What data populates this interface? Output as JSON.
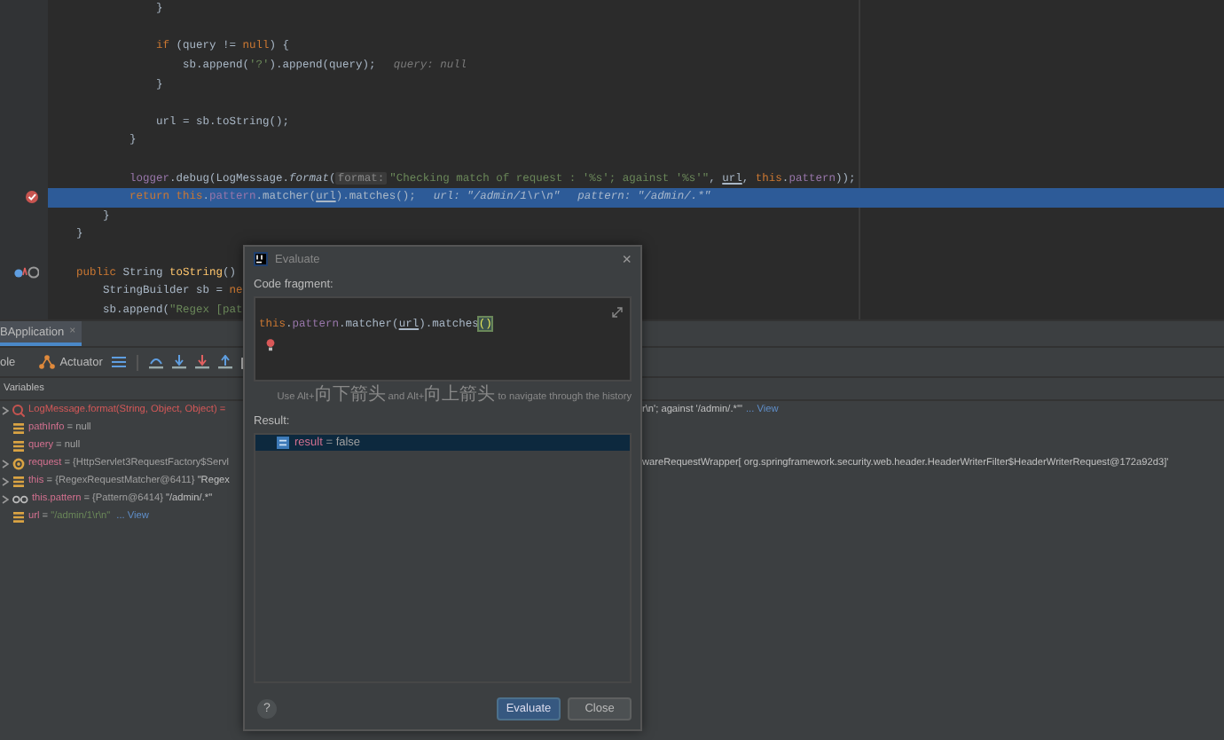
{
  "editor": {
    "lines": [
      {
        "kind": "code",
        "segments": [
          {
            "t": "                }",
            "kind": "plain"
          }
        ]
      },
      {
        "kind": "blank"
      },
      {
        "kind": "code",
        "segments": [
          {
            "t": "                if",
            "kind": "kw"
          },
          {
            "t": " (query != ",
            "kind": "plain"
          },
          {
            "t": "null",
            "kind": "kw"
          },
          {
            "t": ") {",
            "kind": "plain"
          }
        ]
      },
      {
        "kind": "code",
        "segments": [
          {
            "t": "                    sb.append(",
            "kind": "plain"
          },
          {
            "t": "'?'",
            "kind": "str"
          },
          {
            "t": ").append(query);",
            "kind": "plain"
          },
          {
            "t": "query: null",
            "kind": "hint"
          }
        ]
      },
      {
        "kind": "code",
        "segments": [
          {
            "t": "                }",
            "kind": "plain"
          }
        ]
      },
      {
        "kind": "blank"
      },
      {
        "kind": "code",
        "segments": [
          {
            "t": "                url = sb.toString();",
            "kind": "plain"
          }
        ]
      },
      {
        "kind": "code",
        "segments": [
          {
            "t": "            }",
            "kind": "plain"
          }
        ]
      },
      {
        "kind": "blank"
      },
      {
        "kind": "code",
        "segments": [
          {
            "t": "            logger",
            "kind": "field"
          },
          {
            "t": ".debug(LogMessage.",
            "kind": "plain"
          },
          {
            "t": "format",
            "kind": "italic"
          },
          {
            "t": "(",
            "kind": "plain"
          },
          {
            "t": "format:",
            "kind": "inlay"
          },
          {
            "t": "\"Checking match of request : '%s'; against '%s'\"",
            "kind": "str"
          },
          {
            "t": ", ",
            "kind": "plain"
          },
          {
            "t": "url",
            "kind": "under"
          },
          {
            "t": ", ",
            "kind": "plain"
          },
          {
            "t": "this",
            "kind": "kw"
          },
          {
            "t": ".",
            "kind": "plain"
          },
          {
            "t": "pattern",
            "kind": "field"
          },
          {
            "t": "));",
            "kind": "plain"
          }
        ]
      },
      {
        "kind": "code",
        "current": true,
        "breakpoint": true,
        "segments": [
          {
            "t": "            return this",
            "kind": "kw"
          },
          {
            "t": ".",
            "kind": "plain"
          },
          {
            "t": "pattern",
            "kind": "field"
          },
          {
            "t": ".matcher(",
            "kind": "plain"
          },
          {
            "t": "url",
            "kind": "under"
          },
          {
            "t": ").matches();",
            "kind": "plain"
          },
          {
            "t": "url: \"/admin/1\\r\\n\"",
            "kind": "hint"
          },
          {
            "t": "pattern: \"/admin/.*\"",
            "kind": "hint"
          }
        ]
      },
      {
        "kind": "code",
        "segments": [
          {
            "t": "        }",
            "kind": "plain"
          }
        ]
      },
      {
        "kind": "code",
        "segments": [
          {
            "t": "    }",
            "kind": "plain"
          }
        ]
      },
      {
        "kind": "blank"
      },
      {
        "kind": "code",
        "overrides": true,
        "segments": [
          {
            "t": "    public ",
            "kind": "kw"
          },
          {
            "t": "String ",
            "kind": "plain"
          },
          {
            "t": "toString",
            "kind": "method"
          },
          {
            "t": "()",
            "kind": "plain"
          }
        ]
      },
      {
        "kind": "code",
        "segments": [
          {
            "t": "        StringBuilder sb = ",
            "kind": "plain"
          },
          {
            "t": "ne",
            "kind": "kw"
          }
        ]
      },
      {
        "kind": "code",
        "segments": [
          {
            "t": "        sb.append(",
            "kind": "plain"
          },
          {
            "t": "\"Regex [pat",
            "kind": "str"
          }
        ]
      }
    ]
  },
  "debug_panel": {
    "tabs": [
      {
        "label": "BApplication",
        "close": "×",
        "selected": true
      }
    ],
    "toolbar": {
      "console_tab": "ole",
      "actuator": "Actuator"
    },
    "variables": {
      "title": "Variables",
      "rows": [
        {
          "kind": "method",
          "expandable": true,
          "segments": [
            {
              "t": "LogMessage.format(String, Object, Object) =",
              "kind": "ret"
            }
          ],
          "overflow": [
            {
              "t": "r\\n'; against '/admin/.*'\"",
              "kind": "val"
            },
            {
              "t": "... View",
              "kind": "link"
            }
          ]
        },
        {
          "kind": "field",
          "expandable": false,
          "segments": [
            {
              "t": "pathInfo",
              "kind": "name"
            },
            {
              "t": " = null",
              "kind": "grey"
            }
          ]
        },
        {
          "kind": "field",
          "expandable": false,
          "segments": [
            {
              "t": "query",
              "kind": "name"
            },
            {
              "t": " = null",
              "kind": "grey"
            }
          ]
        },
        {
          "kind": "param",
          "expandable": true,
          "segments": [
            {
              "t": "request",
              "kind": "name"
            },
            {
              "t": " = {HttpServlet3RequestFactory$Servl",
              "kind": "grey"
            }
          ],
          "overflow": [
            {
              "t": "wareRequestWrapper[ org.springframework.security.web.header.HeaderWriterFilter$HeaderWriterRequest@172a92d3]'",
              "kind": "val"
            }
          ]
        },
        {
          "kind": "field",
          "expandable": true,
          "segments": [
            {
              "t": "this",
              "kind": "name"
            },
            {
              "t": " = {RegexRequestMatcher@6411} ",
              "kind": "grey"
            },
            {
              "t": "\"Regex",
              "kind": "val"
            }
          ]
        },
        {
          "kind": "watch",
          "expandable": true,
          "segments": [
            {
              "t": "this.pattern",
              "kind": "name"
            },
            {
              "t": " = {Pattern@6414} ",
              "kind": "grey"
            },
            {
              "t": "\"/admin/.*\"",
              "kind": "val"
            }
          ]
        },
        {
          "kind": "field",
          "expandable": false,
          "segments": [
            {
              "t": "url",
              "kind": "name"
            },
            {
              "t": " = ",
              "kind": "grey"
            },
            {
              "t": "\"/admin/1\\r\\n\"",
              "kind": "str"
            },
            {
              "t": " ... View",
              "kind": "link"
            }
          ]
        }
      ]
    }
  },
  "dialog": {
    "title": "Evaluate",
    "close": "×",
    "code_label": "Code fragment:",
    "code": [
      {
        "t": "this",
        "kind": "kw"
      },
      {
        "t": ".",
        "kind": "plain"
      },
      {
        "t": "pattern",
        "kind": "field"
      },
      {
        "t": ".matcher(",
        "kind": "plain"
      },
      {
        "t": "url",
        "kind": "under"
      },
      {
        "t": ").matches",
        "kind": "plain"
      },
      {
        "t": "()",
        "kind": "brace"
      }
    ],
    "hint": [
      {
        "t": "Use Alt+",
        "kind": "latin"
      },
      {
        "t": "向下箭头",
        "kind": "cjk"
      },
      {
        "t": " and Alt+",
        "kind": "latin"
      },
      {
        "t": "向上箭头",
        "kind": "cjk"
      },
      {
        "t": " to navigate through the history",
        "kind": "latin"
      }
    ],
    "result_label": "Result:",
    "results": [
      {
        "selected": true,
        "segments": [
          {
            "t": "result",
            "kind": "name"
          },
          {
            "t": " = false",
            "kind": "grey"
          }
        ]
      }
    ],
    "help": "?",
    "buttons": [
      {
        "label": "Evaluate",
        "primary": true
      },
      {
        "label": "Close",
        "primary": false
      }
    ]
  }
}
